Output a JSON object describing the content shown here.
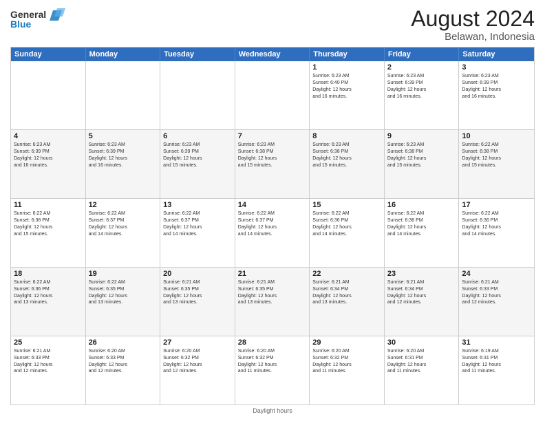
{
  "header": {
    "logo_line1": "General",
    "logo_line2": "Blue",
    "title": "August 2024",
    "subtitle": "Belawan, Indonesia"
  },
  "weekdays": [
    "Sunday",
    "Monday",
    "Tuesday",
    "Wednesday",
    "Thursday",
    "Friday",
    "Saturday"
  ],
  "rows": [
    [
      {
        "day": "",
        "info": ""
      },
      {
        "day": "",
        "info": ""
      },
      {
        "day": "",
        "info": ""
      },
      {
        "day": "",
        "info": ""
      },
      {
        "day": "1",
        "info": "Sunrise: 6:23 AM\nSunset: 6:40 PM\nDaylight: 12 hours\nand 16 minutes."
      },
      {
        "day": "2",
        "info": "Sunrise: 6:23 AM\nSunset: 6:39 PM\nDaylight: 12 hours\nand 16 minutes."
      },
      {
        "day": "3",
        "info": "Sunrise: 6:23 AM\nSunset: 6:39 PM\nDaylight: 12 hours\nand 16 minutes."
      }
    ],
    [
      {
        "day": "4",
        "info": "Sunrise: 6:23 AM\nSunset: 6:39 PM\nDaylight: 12 hours\nand 16 minutes."
      },
      {
        "day": "5",
        "info": "Sunrise: 6:23 AM\nSunset: 6:39 PM\nDaylight: 12 hours\nand 16 minutes."
      },
      {
        "day": "6",
        "info": "Sunrise: 6:23 AM\nSunset: 6:39 PM\nDaylight: 12 hours\nand 15 minutes."
      },
      {
        "day": "7",
        "info": "Sunrise: 6:23 AM\nSunset: 6:38 PM\nDaylight: 12 hours\nand 15 minutes."
      },
      {
        "day": "8",
        "info": "Sunrise: 6:23 AM\nSunset: 6:38 PM\nDaylight: 12 hours\nand 15 minutes."
      },
      {
        "day": "9",
        "info": "Sunrise: 6:23 AM\nSunset: 6:38 PM\nDaylight: 12 hours\nand 15 minutes."
      },
      {
        "day": "10",
        "info": "Sunrise: 6:22 AM\nSunset: 6:38 PM\nDaylight: 12 hours\nand 15 minutes."
      }
    ],
    [
      {
        "day": "11",
        "info": "Sunrise: 6:22 AM\nSunset: 6:38 PM\nDaylight: 12 hours\nand 15 minutes."
      },
      {
        "day": "12",
        "info": "Sunrise: 6:22 AM\nSunset: 6:37 PM\nDaylight: 12 hours\nand 14 minutes."
      },
      {
        "day": "13",
        "info": "Sunrise: 6:22 AM\nSunset: 6:37 PM\nDaylight: 12 hours\nand 14 minutes."
      },
      {
        "day": "14",
        "info": "Sunrise: 6:22 AM\nSunset: 6:37 PM\nDaylight: 12 hours\nand 14 minutes."
      },
      {
        "day": "15",
        "info": "Sunrise: 6:22 AM\nSunset: 6:36 PM\nDaylight: 12 hours\nand 14 minutes."
      },
      {
        "day": "16",
        "info": "Sunrise: 6:22 AM\nSunset: 6:36 PM\nDaylight: 12 hours\nand 14 minutes."
      },
      {
        "day": "17",
        "info": "Sunrise: 6:22 AM\nSunset: 6:36 PM\nDaylight: 12 hours\nand 14 minutes."
      }
    ],
    [
      {
        "day": "18",
        "info": "Sunrise: 6:22 AM\nSunset: 6:36 PM\nDaylight: 12 hours\nand 13 minutes."
      },
      {
        "day": "19",
        "info": "Sunrise: 6:22 AM\nSunset: 6:35 PM\nDaylight: 12 hours\nand 13 minutes."
      },
      {
        "day": "20",
        "info": "Sunrise: 6:21 AM\nSunset: 6:35 PM\nDaylight: 12 hours\nand 13 minutes."
      },
      {
        "day": "21",
        "info": "Sunrise: 6:21 AM\nSunset: 6:35 PM\nDaylight: 12 hours\nand 13 minutes."
      },
      {
        "day": "22",
        "info": "Sunrise: 6:21 AM\nSunset: 6:34 PM\nDaylight: 12 hours\nand 13 minutes."
      },
      {
        "day": "23",
        "info": "Sunrise: 6:21 AM\nSunset: 6:34 PM\nDaylight: 12 hours\nand 12 minutes."
      },
      {
        "day": "24",
        "info": "Sunrise: 6:21 AM\nSunset: 6:33 PM\nDaylight: 12 hours\nand 12 minutes."
      }
    ],
    [
      {
        "day": "25",
        "info": "Sunrise: 6:21 AM\nSunset: 6:33 PM\nDaylight: 12 hours\nand 12 minutes."
      },
      {
        "day": "26",
        "info": "Sunrise: 6:20 AM\nSunset: 6:33 PM\nDaylight: 12 hours\nand 12 minutes."
      },
      {
        "day": "27",
        "info": "Sunrise: 6:20 AM\nSunset: 6:32 PM\nDaylight: 12 hours\nand 12 minutes."
      },
      {
        "day": "28",
        "info": "Sunrise: 6:20 AM\nSunset: 6:32 PM\nDaylight: 12 hours\nand 11 minutes."
      },
      {
        "day": "29",
        "info": "Sunrise: 6:20 AM\nSunset: 6:32 PM\nDaylight: 12 hours\nand 11 minutes."
      },
      {
        "day": "30",
        "info": "Sunrise: 6:20 AM\nSunset: 6:31 PM\nDaylight: 12 hours\nand 11 minutes."
      },
      {
        "day": "31",
        "info": "Sunrise: 6:19 AM\nSunset: 6:31 PM\nDaylight: 12 hours\nand 11 minutes."
      }
    ]
  ],
  "footer": "Daylight hours"
}
